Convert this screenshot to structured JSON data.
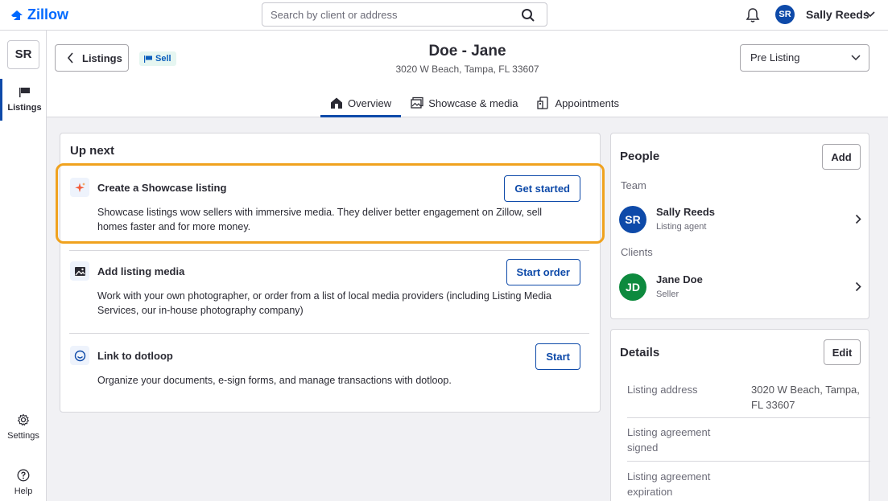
{
  "topbar": {
    "logo": "Zillow",
    "search_placeholder": "Search by client or address",
    "user_initials": "SR",
    "user_name": "Sally Reeds"
  },
  "rail": {
    "initials": "SR",
    "listings_label": "Listings",
    "settings_label": "Settings",
    "help_label": "Help"
  },
  "header": {
    "back_label": "Listings",
    "badge_label": "Sell",
    "title": "Doe - Jane",
    "address": "3020 W Beach, Tampa, FL 33607",
    "stage": "Pre Listing",
    "tabs": [
      {
        "label": "Overview",
        "icon": "home-icon",
        "active": true
      },
      {
        "label": "Showcase & media",
        "icon": "image-icon",
        "active": false
      },
      {
        "label": "Appointments",
        "icon": "appointment-icon",
        "active": false
      }
    ]
  },
  "upnext": {
    "title": "Up next",
    "tasks": [
      {
        "title": "Create a Showcase listing",
        "description": "Showcase listings wow sellers with immersive media. They deliver better engagement on Zillow, sell homes faster and for more money.",
        "button": "Get started",
        "icon": "sparkle-icon"
      },
      {
        "title": "Add listing media",
        "description": "Work with your own photographer, or order from a list of local media providers (including Listing Media Services, our in-house photography company)",
        "button": "Start order",
        "icon": "photo-icon"
      },
      {
        "title": "Link to dotloop",
        "description": "Organize your documents, e-sign forms, and manage transactions with dotloop.",
        "button": "Start",
        "icon": "dotloop-icon"
      }
    ]
  },
  "people": {
    "title": "People",
    "add_label": "Add",
    "team_label": "Team",
    "clients_label": "Clients",
    "team": [
      {
        "initials": "SR",
        "name": "Sally Reeds",
        "role": "Listing agent",
        "color": "#0e4aa9"
      }
    ],
    "clients": [
      {
        "initials": "JD",
        "name": "Jane Doe",
        "role": "Seller",
        "color": "#0d8a3e"
      }
    ]
  },
  "details": {
    "title": "Details",
    "edit_label": "Edit",
    "rows": [
      {
        "label": "Listing address",
        "value": "3020 W Beach, Tampa, FL 33607"
      },
      {
        "label": "Listing agreement signed",
        "value": ""
      },
      {
        "label": "Listing agreement expiration",
        "value": ""
      }
    ]
  },
  "colors": {
    "brand": "#006aff",
    "accent": "#0e4aa9",
    "highlight": "#f0a21e"
  }
}
